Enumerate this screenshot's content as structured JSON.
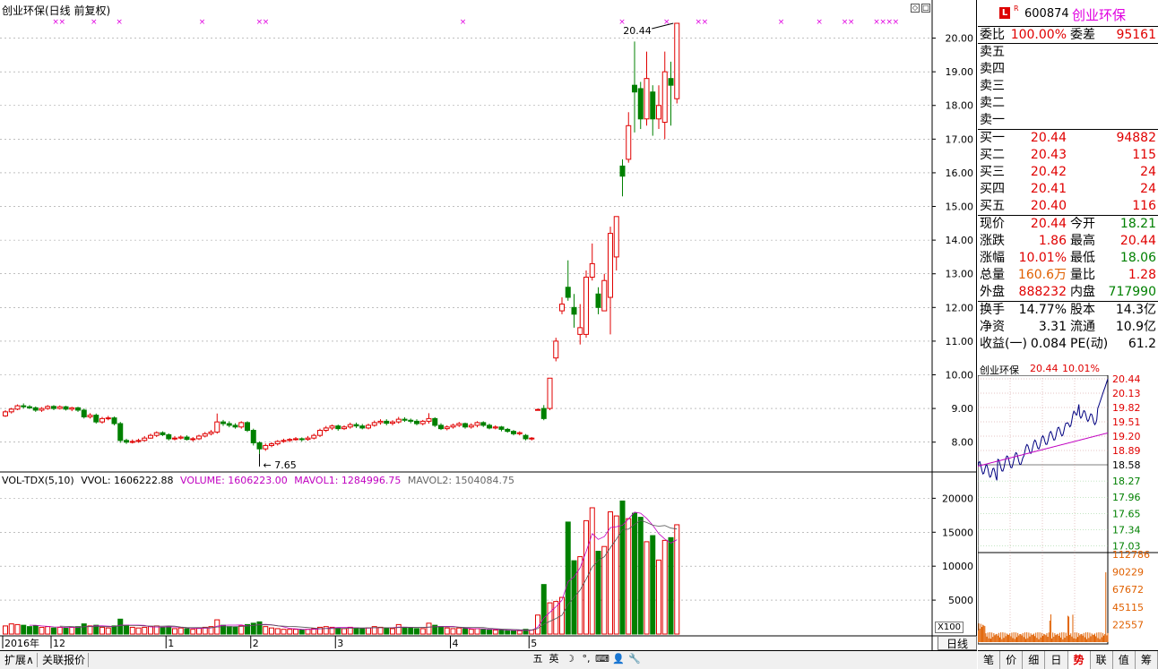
{
  "main_title": "创业环保(日线 前复权)",
  "sub_title": {
    "indicator": "VOL-TDX(5,10)",
    "vvol": "VVOL: 1606222.88",
    "volume": "VOLUME: 1606223.00",
    "mavol1": "MAVOL1: 1284996.75",
    "mavol2": "MAVOL2: 1504084.75"
  },
  "price_axis": [
    "20.00",
    "19.00",
    "18.00",
    "17.00",
    "16.00",
    "15.00",
    "14.00",
    "13.00",
    "12.00",
    "11.00",
    "10.00",
    "9.00",
    "8.00"
  ],
  "vol_axis": [
    "20000",
    "15000",
    "10000",
    "5000"
  ],
  "vol_unit": "X100",
  "period_btn": "日线",
  "date_labels": [
    {
      "t": "2016年",
      "i": 0
    },
    {
      "t": "12",
      "i": 8
    },
    {
      "t": "1",
      "i": 27
    },
    {
      "t": "2",
      "i": 41
    },
    {
      "t": "3",
      "i": 55
    },
    {
      "t": "4",
      "i": 74
    },
    {
      "t": "5",
      "i": 87
    }
  ],
  "annotations": {
    "high": "20.44",
    "low": "7.65"
  },
  "stock": {
    "code": "600874",
    "name": "创业环保",
    "badge_l": "L",
    "badge_r": "R"
  },
  "weibi": {
    "l1": "委比",
    "v1": "100.00%",
    "l2": "委差",
    "v2": "95161"
  },
  "sells": [
    {
      "label": "卖五",
      "price": "",
      "vol": ""
    },
    {
      "label": "卖四",
      "price": "",
      "vol": ""
    },
    {
      "label": "卖三",
      "price": "",
      "vol": ""
    },
    {
      "label": "卖二",
      "price": "",
      "vol": ""
    },
    {
      "label": "卖一",
      "price": "",
      "vol": ""
    }
  ],
  "buys": [
    {
      "label": "买一",
      "price": "20.44",
      "vol": "94882"
    },
    {
      "label": "买二",
      "price": "20.43",
      "vol": "115"
    },
    {
      "label": "买三",
      "price": "20.42",
      "vol": "24"
    },
    {
      "label": "买四",
      "price": "20.41",
      "vol": "24"
    },
    {
      "label": "买五",
      "price": "20.40",
      "vol": "116"
    }
  ],
  "quote": [
    {
      "l1": "现价",
      "v1": "20.44",
      "c1": "red",
      "l2": "今开",
      "v2": "18.21",
      "c2": "green"
    },
    {
      "l1": "涨跌",
      "v1": "1.86",
      "c1": "red",
      "l2": "最高",
      "v2": "20.44",
      "c2": "red"
    },
    {
      "l1": "涨幅",
      "v1": "10.01%",
      "c1": "red",
      "l2": "最低",
      "v2": "18.06",
      "c2": "green"
    },
    {
      "l1": "总量",
      "v1": "160.6万",
      "c1": "orange",
      "l2": "量比",
      "v2": "1.28",
      "c2": "red"
    },
    {
      "l1": "外盘",
      "v1": "888232",
      "c1": "red",
      "l2": "内盘",
      "v2": "717990",
      "c2": "green"
    }
  ],
  "finance": [
    {
      "l1": "换手",
      "v1": "14.77%",
      "l2": "股本",
      "v2": "14.3亿"
    },
    {
      "l1": "净资",
      "v1": "3.31",
      "l2": "流通",
      "v2": "10.9亿"
    },
    {
      "l1": "收益(一)",
      "v1": "0.084",
      "l2": "PE(动)",
      "v2": "61.2"
    }
  ],
  "mini": {
    "name": "创业环保",
    "price": "20.44",
    "pct": "10.01%",
    "axis_up": [
      "20.44",
      "20.13",
      "19.82",
      "19.51",
      "19.20",
      "18.89"
    ],
    "axis_mid": "18.58",
    "axis_down": [
      "18.27",
      "17.96",
      "17.65",
      "17.34",
      "17.03"
    ],
    "vol_axis": [
      "112786",
      "90229",
      "67672",
      "45115",
      "22557"
    ]
  },
  "status_bar": {
    "expand": "扩展∧",
    "linked": "关联报价"
  },
  "ime": [
    "五",
    "英",
    "☽",
    "°,",
    "⌨",
    "👤",
    "🔧"
  ],
  "right_tabs": [
    "笔",
    "价",
    "细",
    "日",
    "势",
    "联",
    "值",
    "筹"
  ],
  "active_tab": "势",
  "colors": {
    "up": "#e00000",
    "down": "#008000",
    "ma1": "#c000c0",
    "ma2": "#000000",
    "grid": "#999999"
  },
  "chart_data": {
    "type": "candlestick",
    "ylim": [
      7.3,
      20.6
    ],
    "vol_ylim": [
      0,
      21500
    ],
    "candles": [
      [
        8.78,
        8.9,
        8.95,
        8.75,
        1200
      ],
      [
        8.9,
        8.98,
        9.02,
        8.85,
        1500
      ],
      [
        8.98,
        9.08,
        9.12,
        8.95,
        1400
      ],
      [
        9.08,
        9.05,
        9.15,
        9.0,
        1300
      ],
      [
        9.05,
        9.02,
        9.1,
        8.98,
        1100
      ],
      [
        9.02,
        8.95,
        9.06,
        8.9,
        1200
      ],
      [
        8.95,
        9.0,
        9.04,
        8.9,
        1000
      ],
      [
        9.0,
        9.06,
        9.1,
        8.96,
        1100
      ],
      [
        9.06,
        9.0,
        9.1,
        8.95,
        900
      ],
      [
        9.0,
        9.05,
        9.09,
        8.97,
        1000
      ],
      [
        9.05,
        8.98,
        9.08,
        8.94,
        900
      ],
      [
        8.98,
        9.02,
        9.05,
        8.92,
        1000
      ],
      [
        9.02,
        8.95,
        9.05,
        8.9,
        1100
      ],
      [
        8.95,
        8.75,
        9.0,
        8.7,
        1500
      ],
      [
        8.75,
        8.8,
        8.86,
        8.7,
        1200
      ],
      [
        8.8,
        8.6,
        8.85,
        8.55,
        1300
      ],
      [
        8.6,
        8.7,
        8.75,
        8.55,
        1000
      ],
      [
        8.7,
        8.72,
        8.78,
        8.65,
        900
      ],
      [
        8.72,
        8.55,
        8.76,
        8.5,
        1200
      ],
      [
        8.55,
        8.05,
        8.6,
        7.98,
        2200
      ],
      [
        8.05,
        8.0,
        8.1,
        7.95,
        1300
      ],
      [
        8.0,
        8.02,
        8.08,
        7.96,
        1000
      ],
      [
        8.02,
        8.05,
        8.1,
        7.98,
        900
      ],
      [
        8.05,
        8.12,
        8.18,
        8.02,
        1000
      ],
      [
        8.12,
        8.2,
        8.25,
        8.1,
        1100
      ],
      [
        8.2,
        8.28,
        8.32,
        8.15,
        1200
      ],
      [
        8.28,
        8.22,
        8.32,
        8.18,
        1000
      ],
      [
        8.22,
        8.1,
        8.26,
        8.05,
        1100
      ],
      [
        8.1,
        8.12,
        8.18,
        8.05,
        800
      ],
      [
        8.12,
        8.15,
        8.2,
        8.08,
        900
      ],
      [
        8.15,
        8.08,
        8.2,
        8.05,
        800
      ],
      [
        8.08,
        8.1,
        8.15,
        8.02,
        700
      ],
      [
        8.1,
        8.18,
        8.22,
        8.06,
        900
      ],
      [
        8.18,
        8.25,
        8.3,
        8.14,
        1000
      ],
      [
        8.25,
        8.3,
        8.36,
        8.2,
        1100
      ],
      [
        8.3,
        8.6,
        8.85,
        8.25,
        2100
      ],
      [
        8.6,
        8.55,
        8.66,
        8.48,
        1300
      ],
      [
        8.55,
        8.5,
        8.62,
        8.44,
        1100
      ],
      [
        8.5,
        8.45,
        8.56,
        8.4,
        1000
      ],
      [
        8.45,
        8.58,
        8.62,
        8.4,
        1200
      ],
      [
        8.58,
        8.35,
        8.62,
        8.3,
        1400
      ],
      [
        8.35,
        7.98,
        8.4,
        7.9,
        1600
      ],
      [
        7.98,
        7.8,
        8.02,
        7.65,
        1800
      ],
      [
        7.8,
        7.9,
        7.96,
        7.74,
        1100
      ],
      [
        7.9,
        7.95,
        8.0,
        7.85,
        900
      ],
      [
        7.95,
        8.02,
        8.06,
        7.9,
        800
      ],
      [
        8.02,
        8.05,
        8.1,
        7.98,
        700
      ],
      [
        8.05,
        8.08,
        8.12,
        8.0,
        700
      ],
      [
        8.08,
        8.1,
        8.15,
        8.04,
        700
      ],
      [
        8.1,
        8.08,
        8.14,
        8.02,
        600
      ],
      [
        8.08,
        8.12,
        8.18,
        8.04,
        700
      ],
      [
        8.12,
        8.2,
        8.25,
        8.08,
        800
      ],
      [
        8.2,
        8.35,
        8.4,
        8.15,
        1000
      ],
      [
        8.35,
        8.42,
        8.48,
        8.3,
        1100
      ],
      [
        8.42,
        8.48,
        8.52,
        8.36,
        1000
      ],
      [
        8.48,
        8.4,
        8.52,
        8.34,
        900
      ],
      [
        8.4,
        8.45,
        8.5,
        8.36,
        800
      ],
      [
        8.45,
        8.52,
        8.58,
        8.4,
        1000
      ],
      [
        8.52,
        8.48,
        8.58,
        8.42,
        900
      ],
      [
        8.48,
        8.42,
        8.54,
        8.38,
        800
      ],
      [
        8.42,
        8.5,
        8.55,
        8.38,
        900
      ],
      [
        8.5,
        8.58,
        8.64,
        8.46,
        1100
      ],
      [
        8.58,
        8.62,
        8.68,
        8.52,
        1000
      ],
      [
        8.62,
        8.56,
        8.68,
        8.5,
        900
      ],
      [
        8.56,
        8.6,
        8.65,
        8.5,
        800
      ],
      [
        8.6,
        8.68,
        8.75,
        8.55,
        1400
      ],
      [
        8.68,
        8.65,
        8.74,
        8.6,
        1000
      ],
      [
        8.65,
        8.62,
        8.7,
        8.56,
        900
      ],
      [
        8.62,
        8.55,
        8.68,
        8.5,
        800
      ],
      [
        8.55,
        8.62,
        8.66,
        8.5,
        800
      ],
      [
        8.62,
        8.7,
        8.86,
        8.55,
        1600
      ],
      [
        8.7,
        8.5,
        8.74,
        8.45,
        1300
      ],
      [
        8.5,
        8.4,
        8.56,
        8.36,
        1100
      ],
      [
        8.4,
        8.45,
        8.5,
        8.35,
        900
      ],
      [
        8.45,
        8.5,
        8.55,
        8.4,
        800
      ],
      [
        8.5,
        8.55,
        8.6,
        8.45,
        900
      ],
      [
        8.55,
        8.45,
        8.58,
        8.4,
        800
      ],
      [
        8.45,
        8.5,
        8.56,
        8.4,
        700
      ],
      [
        8.5,
        8.58,
        8.62,
        8.44,
        800
      ],
      [
        8.58,
        8.5,
        8.62,
        8.45,
        700
      ],
      [
        8.5,
        8.42,
        8.55,
        8.38,
        600
      ],
      [
        8.42,
        8.45,
        8.5,
        8.38,
        600
      ],
      [
        8.45,
        8.38,
        8.48,
        8.32,
        600
      ],
      [
        8.38,
        8.32,
        8.42,
        8.28,
        500
      ],
      [
        8.32,
        8.25,
        8.36,
        8.2,
        500
      ],
      [
        8.25,
        8.28,
        8.32,
        8.2,
        500
      ],
      [
        8.2,
        8.1,
        8.24,
        8.05,
        700
      ],
      [
        8.1,
        8.12,
        8.15,
        8.05,
        600
      ],
      [
        8.95,
        8.97,
        9.0,
        8.95,
        2800
      ],
      [
        9.0,
        8.7,
        9.1,
        8.65,
        7300
      ],
      [
        9.0,
        9.9,
        9.9,
        8.95,
        4600
      ],
      [
        10.5,
        11.0,
        11.1,
        10.4,
        4800
      ],
      [
        11.9,
        12.1,
        12.3,
        11.8,
        5400
      ],
      [
        12.6,
        12.3,
        13.4,
        12.2,
        16500
      ],
      [
        12.0,
        11.8,
        12.4,
        11.4,
        10800
      ],
      [
        11.2,
        11.4,
        12.1,
        10.9,
        11400
      ],
      [
        11.2,
        12.9,
        13.1,
        11.1,
        16700
      ],
      [
        12.9,
        13.3,
        13.9,
        12.8,
        18600
      ],
      [
        12.4,
        12.0,
        12.6,
        11.8,
        12200
      ],
      [
        11.9,
        12.8,
        13.0,
        11.9,
        12900
      ],
      [
        12.3,
        14.2,
        14.4,
        11.2,
        18000
      ],
      [
        13.5,
        14.7,
        14.7,
        13.1,
        17400
      ],
      [
        16.2,
        15.9,
        16.4,
        15.3,
        19600
      ],
      [
        16.4,
        17.4,
        17.8,
        16.3,
        17000
      ],
      [
        18.6,
        18.4,
        19.9,
        17.2,
        17800
      ],
      [
        18.5,
        17.6,
        18.7,
        17.3,
        17200
      ],
      [
        17.6,
        18.8,
        19.6,
        17.4,
        13600
      ],
      [
        18.4,
        17.6,
        18.6,
        17.1,
        14500
      ],
      [
        17.6,
        18.0,
        18.6,
        17.3,
        10900
      ],
      [
        17.5,
        19.0,
        19.6,
        17.0,
        13800
      ],
      [
        18.8,
        18.6,
        19.3,
        17.4,
        14200
      ],
      [
        18.2,
        20.44,
        20.44,
        18.06,
        16100
      ]
    ]
  }
}
